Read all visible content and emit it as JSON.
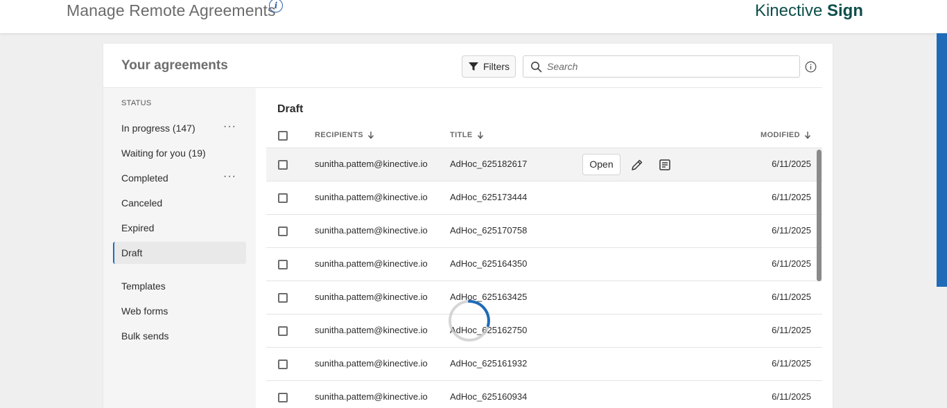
{
  "header": {
    "title": "Manage Remote Agreements",
    "info_icon": "info-icon",
    "brand_prefix": "Kinective",
    "brand_bold": "Sign"
  },
  "panel": {
    "heading": "Your agreements",
    "filters_label": "Filters",
    "search_placeholder": "Search"
  },
  "sidebar": {
    "status_label": "STATUS",
    "items": [
      {
        "label": "In progress (147)",
        "has_more": true
      },
      {
        "label": "Waiting for you (19)",
        "has_more": false
      },
      {
        "label": "Completed",
        "has_more": true
      },
      {
        "label": "Canceled",
        "has_more": false
      },
      {
        "label": "Expired",
        "has_more": false
      },
      {
        "label": "Draft",
        "has_more": false,
        "active": true
      },
      {
        "label": "Templates",
        "has_more": false
      },
      {
        "label": "Web forms",
        "has_more": false
      },
      {
        "label": "Bulk sends",
        "has_more": false
      }
    ],
    "more_symbol": "···"
  },
  "table": {
    "section_title": "Draft",
    "columns": {
      "recipients": "RECIPIENTS",
      "title": "TITLE",
      "modified": "MODIFIED"
    },
    "open_label": "Open",
    "rows": [
      {
        "recipient": "sunitha.pattem@kinective.io",
        "title": "AdHoc_625182617",
        "modified": "6/11/2025"
      },
      {
        "recipient": "sunitha.pattem@kinective.io",
        "title": "AdHoc_625173444",
        "modified": "6/11/2025"
      },
      {
        "recipient": "sunitha.pattem@kinective.io",
        "title": "AdHoc_625170758",
        "modified": "6/11/2025"
      },
      {
        "recipient": "sunitha.pattem@kinective.io",
        "title": "AdHoc_625164350",
        "modified": "6/11/2025"
      },
      {
        "recipient": "sunitha.pattem@kinective.io",
        "title": "AdHoc_625163425",
        "modified": "6/11/2025"
      },
      {
        "recipient": "sunitha.pattem@kinective.io",
        "title": "AdHoc_625162750",
        "modified": "6/11/2025"
      },
      {
        "recipient": "sunitha.pattem@kinective.io",
        "title": "AdHoc_625161932",
        "modified": "6/11/2025"
      },
      {
        "recipient": "sunitha.pattem@kinective.io",
        "title": "AdHoc_625160934",
        "modified": "6/11/2025"
      }
    ]
  },
  "colors": {
    "accent": "#1f6bb8",
    "brand": "#0e4f4a",
    "spinner": "#1f6bb8"
  }
}
